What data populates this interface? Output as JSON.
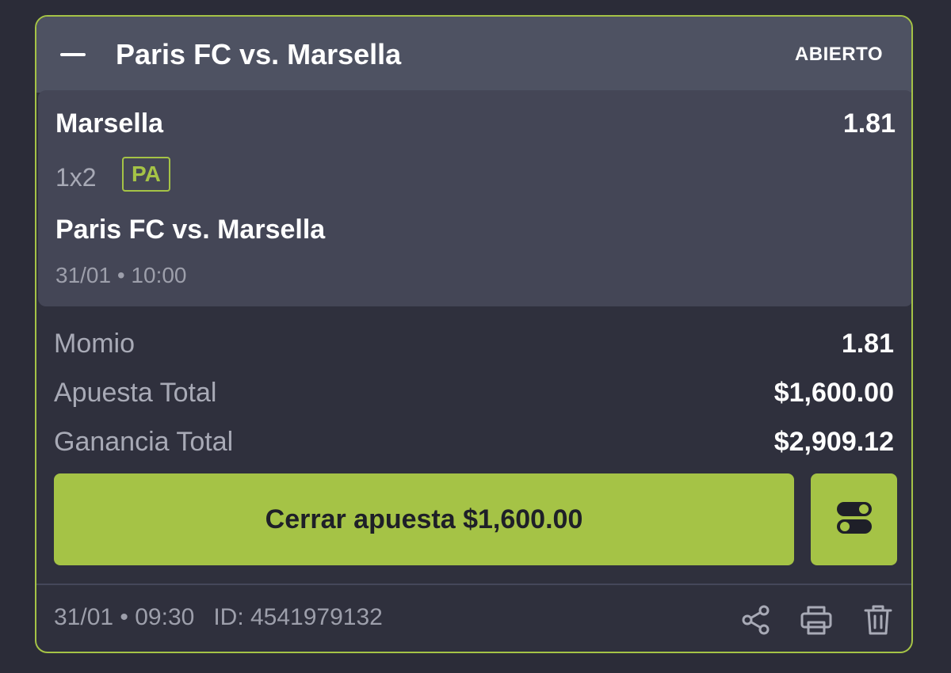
{
  "header": {
    "title": "Paris FC vs. Marsella",
    "status": "ABIERTO"
  },
  "selection": {
    "name": "Marsella",
    "odds": "1.81",
    "market": "1x2",
    "badge": "PA",
    "event": "Paris FC vs. Marsella",
    "event_datetime": "31/01 • 10:00"
  },
  "summary": {
    "rows": [
      {
        "label": "Momio",
        "value": "1.81"
      },
      {
        "label": "Apuesta Total",
        "value": "$1,600.00"
      },
      {
        "label": "Ganancia Total",
        "value": "$2,909.12"
      }
    ]
  },
  "actions": {
    "cashout_label": "Cerrar apuesta $1,600.00",
    "toggle_icon": "toggle-settings-icon"
  },
  "footer": {
    "placed_datetime": "31/01 • 09:30",
    "bet_id": "ID: 4541979132",
    "icons": [
      "share-icon",
      "print-icon",
      "trash-icon"
    ]
  },
  "colors": {
    "accent": "#a5c346",
    "header_bg": "#4e5262",
    "panel_bg": "#444656",
    "card_bg": "#2f303d"
  }
}
